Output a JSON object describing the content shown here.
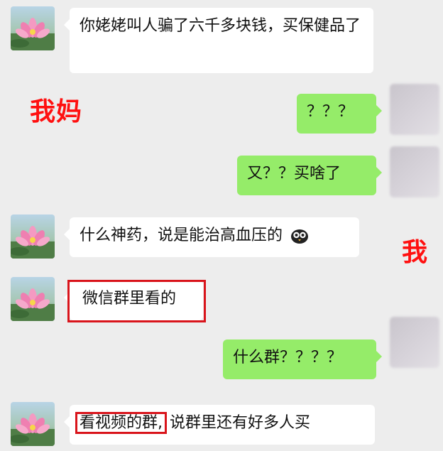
{
  "labels": {
    "mom": "我妈",
    "me": "我"
  },
  "messages": [
    {
      "id": "m1",
      "side": "in",
      "text": "你姥姥叫人骗了六千多块钱，买保健品了"
    },
    {
      "id": "m2",
      "side": "out",
      "text": "？？？"
    },
    {
      "id": "m3",
      "side": "out",
      "text": "又？？买啥了"
    },
    {
      "id": "m4",
      "side": "in",
      "text": "什么神药，说是能治高血压的",
      "emoji": "owl-emoji-icon"
    },
    {
      "id": "m5",
      "side": "in",
      "text": "微信群里看的"
    },
    {
      "id": "m6",
      "side": "out",
      "text": "什么群？？？？"
    },
    {
      "id": "m7",
      "side": "in",
      "highlight_text": "看视频的群,",
      "text": "说群里还有好多人买"
    }
  ],
  "colors": {
    "incoming": "#ffffff",
    "outgoing": "#95ec69",
    "annotation": "#ff1010",
    "background": "#ededed"
  }
}
